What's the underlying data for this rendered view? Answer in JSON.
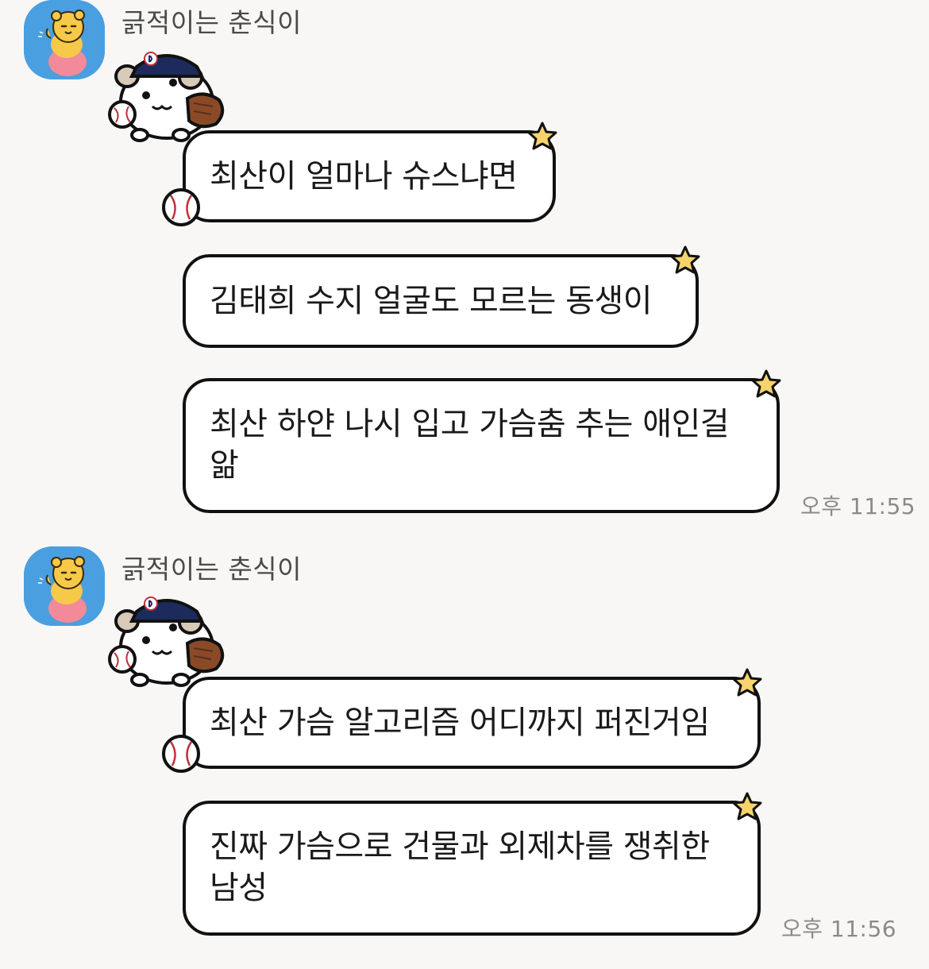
{
  "groups": [
    {
      "sender": "긁적이는 춘식이",
      "messages": [
        {
          "lines": [
            "최산이 얼마나 슈스냐면"
          ]
        },
        {
          "lines": [
            "김태희 수지 얼굴도 모르는 동생이"
          ]
        },
        {
          "lines": [
            "최산 하얀 나시 입고 가슴춤 추는 애인걸",
            "앎"
          ]
        }
      ],
      "time": "오후 11:55"
    },
    {
      "sender": "긁적이는 춘식이",
      "messages": [
        {
          "lines": [
            "최산 가슴 알고리즘 어디까지 퍼진거임"
          ]
        },
        {
          "lines": [
            "진짜 가슴으로 건물과 외제차를 쟁취한",
            "남성"
          ]
        }
      ],
      "time": "오후 11:56"
    }
  ],
  "icons": {
    "avatar": "choonsik-profile-icon",
    "mascot": "baseball-hamster-sticker-icon",
    "star": "star-icon",
    "ball": "baseball-icon"
  },
  "colors": {
    "background": "#f8f7f6",
    "avatar_bg": "#4a9fe0",
    "bubble": "#ffffff",
    "bubble_border": "#111111",
    "star": "#f6d36b",
    "sender_text": "#4a4a4a",
    "time_text": "#8a8a8a"
  }
}
